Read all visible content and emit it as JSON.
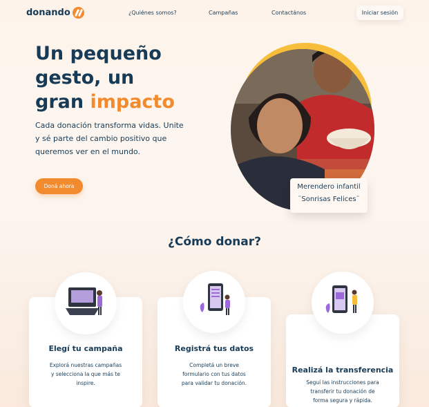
{
  "nav": {
    "logo": "donando",
    "links": [
      "¿Quiénes somos?",
      "Campañas",
      "Contactános"
    ],
    "login": "Iniciar sesión"
  },
  "hero": {
    "title_line1": "Un pequeño",
    "title_line2": "gesto, un",
    "title_line3a": "gran ",
    "title_line3b": "impacto",
    "subtitle": "Cada donación transforma vidas. Unite y sé parte del cambio positivo que queremos ver en el mundo.",
    "cta": "Doná ahora",
    "caption_line1": "Merendero infantil",
    "caption_line2": "¨Sonrisas Felices¨"
  },
  "how": {
    "title": "¿Cómo donar?",
    "cards": [
      {
        "title": "Elegí tu campaña",
        "text": "Explorá nuestras campañas y selecciona la que más te inspire."
      },
      {
        "title": "Registrá tus datos",
        "text": "Completá un breve formulario con tus datos para validar tu donación."
      },
      {
        "title": "Realizá la transferencia",
        "text": "Seguí las instrucciones para transferir tu donación de forma segura y rápida."
      }
    ]
  },
  "colors": {
    "primary": "#173b56",
    "accent": "#f28a2e",
    "yellow": "#f6be3b"
  }
}
